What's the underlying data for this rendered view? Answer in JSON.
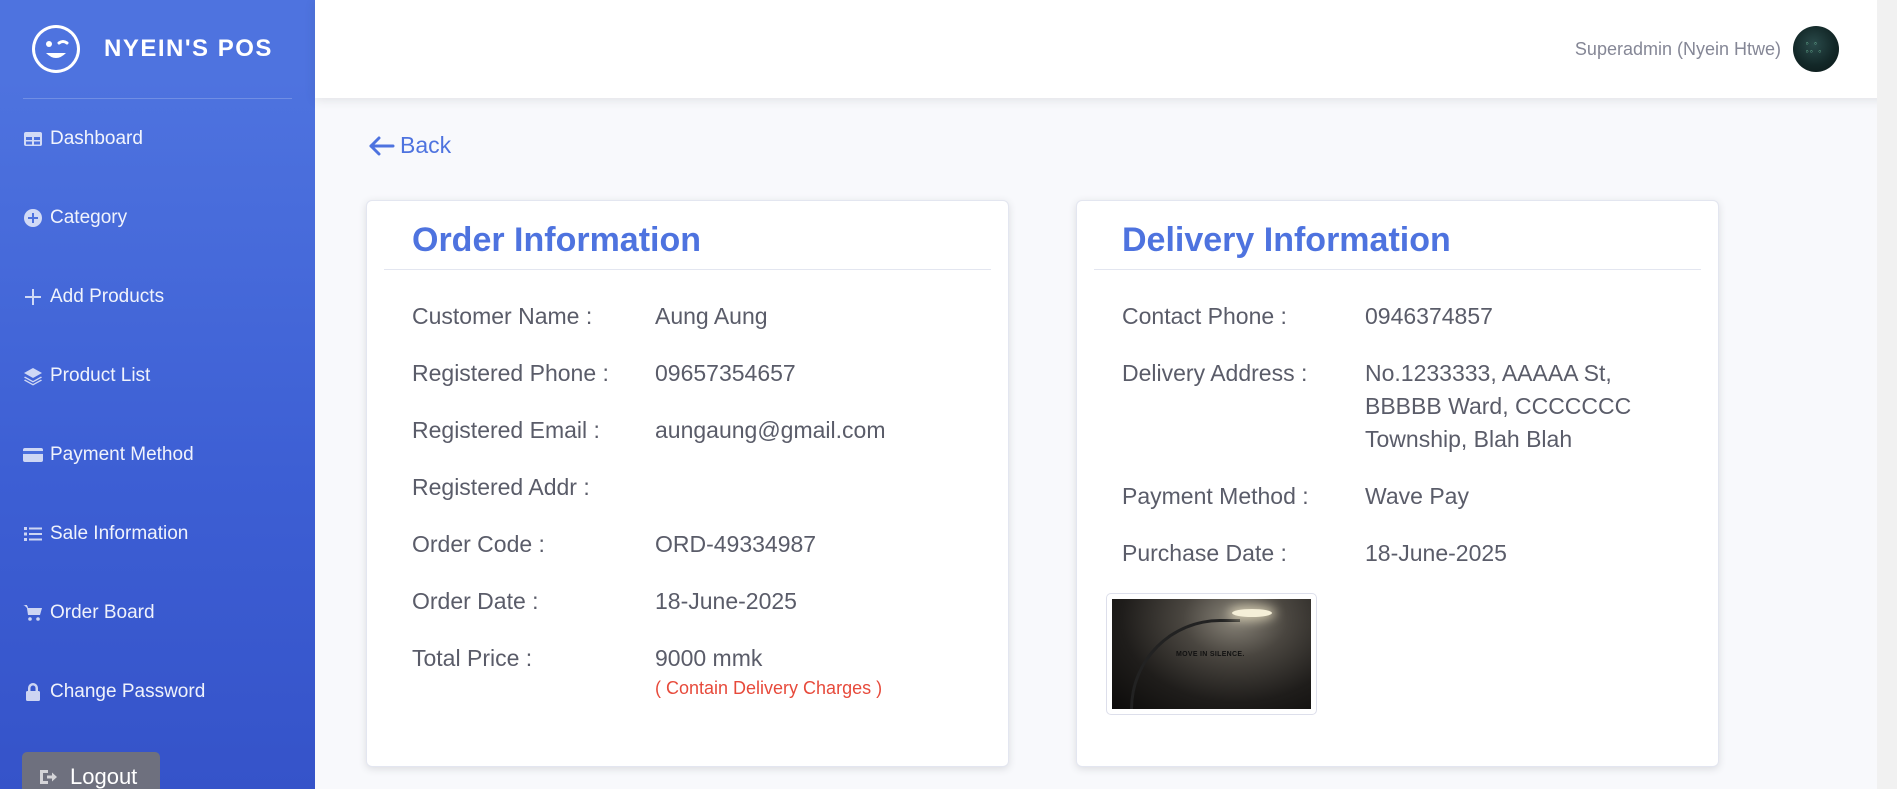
{
  "brand": {
    "name": "NYEIN'S POS"
  },
  "nav": {
    "items": [
      {
        "label": "Dashboard",
        "icon": "table-icon"
      },
      {
        "label": "Category",
        "icon": "plus-circle-icon"
      },
      {
        "label": "Add Products",
        "icon": "plus-icon"
      },
      {
        "label": "Product List",
        "icon": "layers-icon"
      },
      {
        "label": "Payment Method",
        "icon": "credit-card-icon"
      },
      {
        "label": "Sale Information",
        "icon": "list-icon"
      },
      {
        "label": "Order Board",
        "icon": "cart-icon"
      },
      {
        "label": "Change Password",
        "icon": "lock-icon"
      }
    ],
    "logout_label": "Logout"
  },
  "topbar": {
    "user_name": "Superadmin (Nyein Htwe)"
  },
  "back_label": "Back",
  "order": {
    "title": "Order Information",
    "customer_name_label": "Customer Name :",
    "customer_name": "Aung Aung",
    "phone_label": "Registered Phone :",
    "phone": "09657354657",
    "email_label": "Registered Email :",
    "email": "aungaung@gmail.com",
    "addr_label": "Registered Addr :",
    "addr": "",
    "code_label": "Order Code :",
    "code": "ORD-49334987",
    "date_label": "Order Date :",
    "date": "18-June-2025",
    "total_label": "Total Price :",
    "total": "9000 mmk",
    "total_note": "( Contain Delivery Charges )"
  },
  "delivery": {
    "title": "Delivery Information",
    "contact_label": "Contact Phone :",
    "contact": "0946374857",
    "address_label": "Delivery Address :",
    "address": "No.1233333, AAAAA St, BBBBB Ward, CCCCCCC Township, Blah Blah",
    "payment_label": "Payment Method :",
    "payment": "Wave Pay",
    "purchase_label": "Purchase Date :",
    "purchase": "18-June-2025",
    "image_caption": "MOVE IN SILENCE."
  },
  "colors": {
    "primary": "#4e73df",
    "danger": "#e74a3b",
    "text": "#5a5c69"
  }
}
